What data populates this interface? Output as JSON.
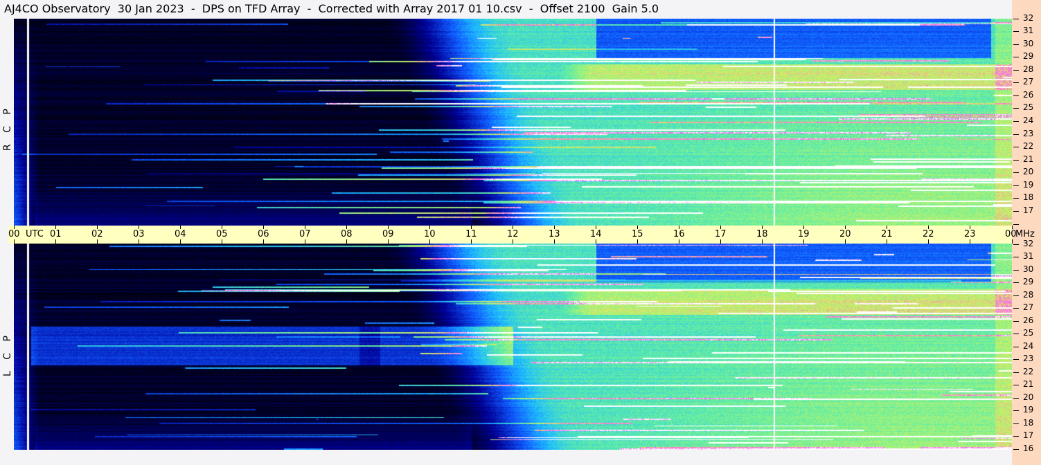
{
  "title": "AJ4CO Observatory  30 Jan 2023  -  DPS on TFD Array  -  Corrected with Array 2017 01 10.csv  -  Offset 2100  Gain 5.0",
  "panels": {
    "top_label": "R C P",
    "bottom_label": "L C P"
  },
  "time_axis": {
    "utc_label": "UTC",
    "unit_label": "MHz"
  },
  "chart_data": {
    "type": "heatmap",
    "title": "AJ4CO Observatory  30 Jan 2023  -  DPS on TFD Array  -  Corrected with Array 2017 01 10.csv  -  Offset 2100  Gain 5.0",
    "x_ticks": [
      "00",
      "01",
      "02",
      "03",
      "04",
      "05",
      "06",
      "07",
      "08",
      "09",
      "10",
      "11",
      "12",
      "13",
      "14",
      "15",
      "16",
      "17",
      "18",
      "19",
      "20",
      "21",
      "22",
      "23",
      "00"
    ],
    "xlabel": "UTC",
    "ylabel": "MHz",
    "xlim_hours": [
      0,
      24
    ],
    "ylim_mhz": [
      16,
      32
    ],
    "y_ticks": [
      32,
      31,
      30,
      29,
      28,
      27,
      26,
      25,
      24,
      23,
      22,
      21,
      20,
      19,
      18,
      17,
      16
    ],
    "series": [
      {
        "name": "R C P"
      },
      {
        "name": "L C P"
      }
    ],
    "colormap": [
      "#000000",
      "#0000a0",
      "#1060ff",
      "#20c0ff",
      "#60f0a0",
      "#e0f060",
      "#ff40ff",
      "#ffffff"
    ]
  }
}
